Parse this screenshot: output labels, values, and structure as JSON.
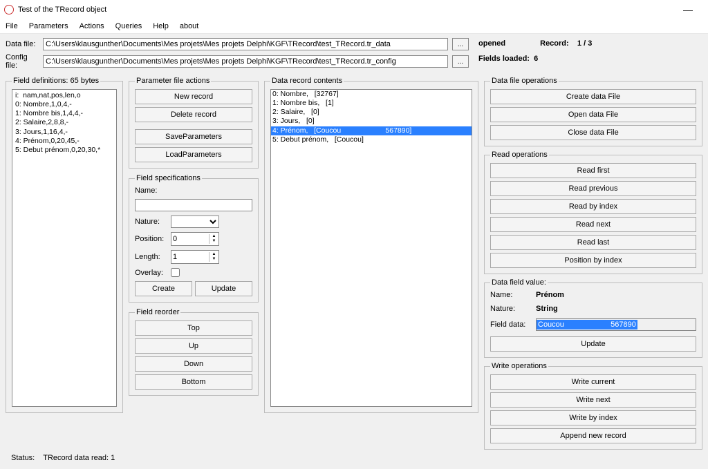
{
  "window": {
    "title": "Test of the TRecord object"
  },
  "menu": {
    "file": "File",
    "parameters": "Parameters",
    "actions": "Actions",
    "queries": "Queries",
    "help": "Help",
    "about": "about"
  },
  "files": {
    "data_label": "Data file:",
    "data_path": "C:\\Users\\klausgunther\\Documents\\Mes projets\\Mes projets Delphi\\KGF\\TRecord\\test_TRecord.tr_data",
    "config_label": "Config file:",
    "config_path": "C:\\Users\\klausgunther\\Documents\\Mes projets\\Mes projets Delphi\\KGF\\TRecord\\test_TRecord.tr_config"
  },
  "status": {
    "opened": "opened",
    "record_label": "Record:",
    "record_value": "1 / 3",
    "fields_loaded_label": "Fields loaded:",
    "fields_loaded_value": "6"
  },
  "field_defs": {
    "legend": "Field definitions: 65 bytes",
    "items": [
      "i:  nam,nat,pos,len,o",
      "0: Nombre,1,0,4,-",
      "1: Nombre bis,1,4,4,-",
      "2: Salaire,2,8,8,-",
      "3: Jours,1,16,4,-",
      "4: Prénom,0,20,45,-",
      "5: Debut prénom,0,20,30,*"
    ]
  },
  "param_actions": {
    "legend": "Parameter file actions",
    "new": "New record",
    "delete": "Delete record",
    "save": "SaveParameters",
    "load": "LoadParameters"
  },
  "field_spec": {
    "legend": "Field specifications",
    "name_label": "Name:",
    "name_value": "",
    "nature_label": "Nature:",
    "nature_value": "",
    "position_label": "Position:",
    "position_value": "0",
    "length_label": "Length:",
    "length_value": "1",
    "overlay_label": "Overlay:",
    "create": "Create",
    "update": "Update"
  },
  "reorder": {
    "legend": "Field reorder",
    "top": "Top",
    "up": "Up",
    "down": "Down",
    "bottom": "Bottom"
  },
  "record_contents": {
    "legend": "Data record contents",
    "items": [
      {
        "text": "0: Nombre,   [32767]",
        "selected": false
      },
      {
        "text": "1: Nombre bis,   [1]",
        "selected": false
      },
      {
        "text": "2: Salaire,   [0]",
        "selected": false
      },
      {
        "text": "3: Jours,   [0]",
        "selected": false
      },
      {
        "text": "4: Prénom,   [Coucou                      567890]",
        "selected": true
      },
      {
        "text": "5: Debut prénom,   [Coucou]",
        "selected": false
      }
    ]
  },
  "data_file_ops": {
    "legend": "Data file operations",
    "create": "Create data File",
    "open": "Open data File",
    "close": "Close data File"
  },
  "read_ops": {
    "legend": "Read operations",
    "first": "Read first",
    "prev": "Read previous",
    "byidx": "Read by index",
    "next": "Read next",
    "last": "Read last",
    "posidx": "Position by index"
  },
  "dfv": {
    "legend": "Data field value:",
    "name_label": "Name:",
    "name_value": "Prénom",
    "nature_label": "Nature:",
    "nature_value": "String",
    "data_label": "Field data:",
    "data_value": "Coucou                      567890",
    "update": "Update"
  },
  "write_ops": {
    "legend": "Write operations",
    "cur": "Write current",
    "next": "Write next",
    "byidx": "Write by index",
    "append": "Append new record"
  },
  "footer": {
    "status_label": "Status:",
    "status_value": "TRecord data read: 1"
  }
}
